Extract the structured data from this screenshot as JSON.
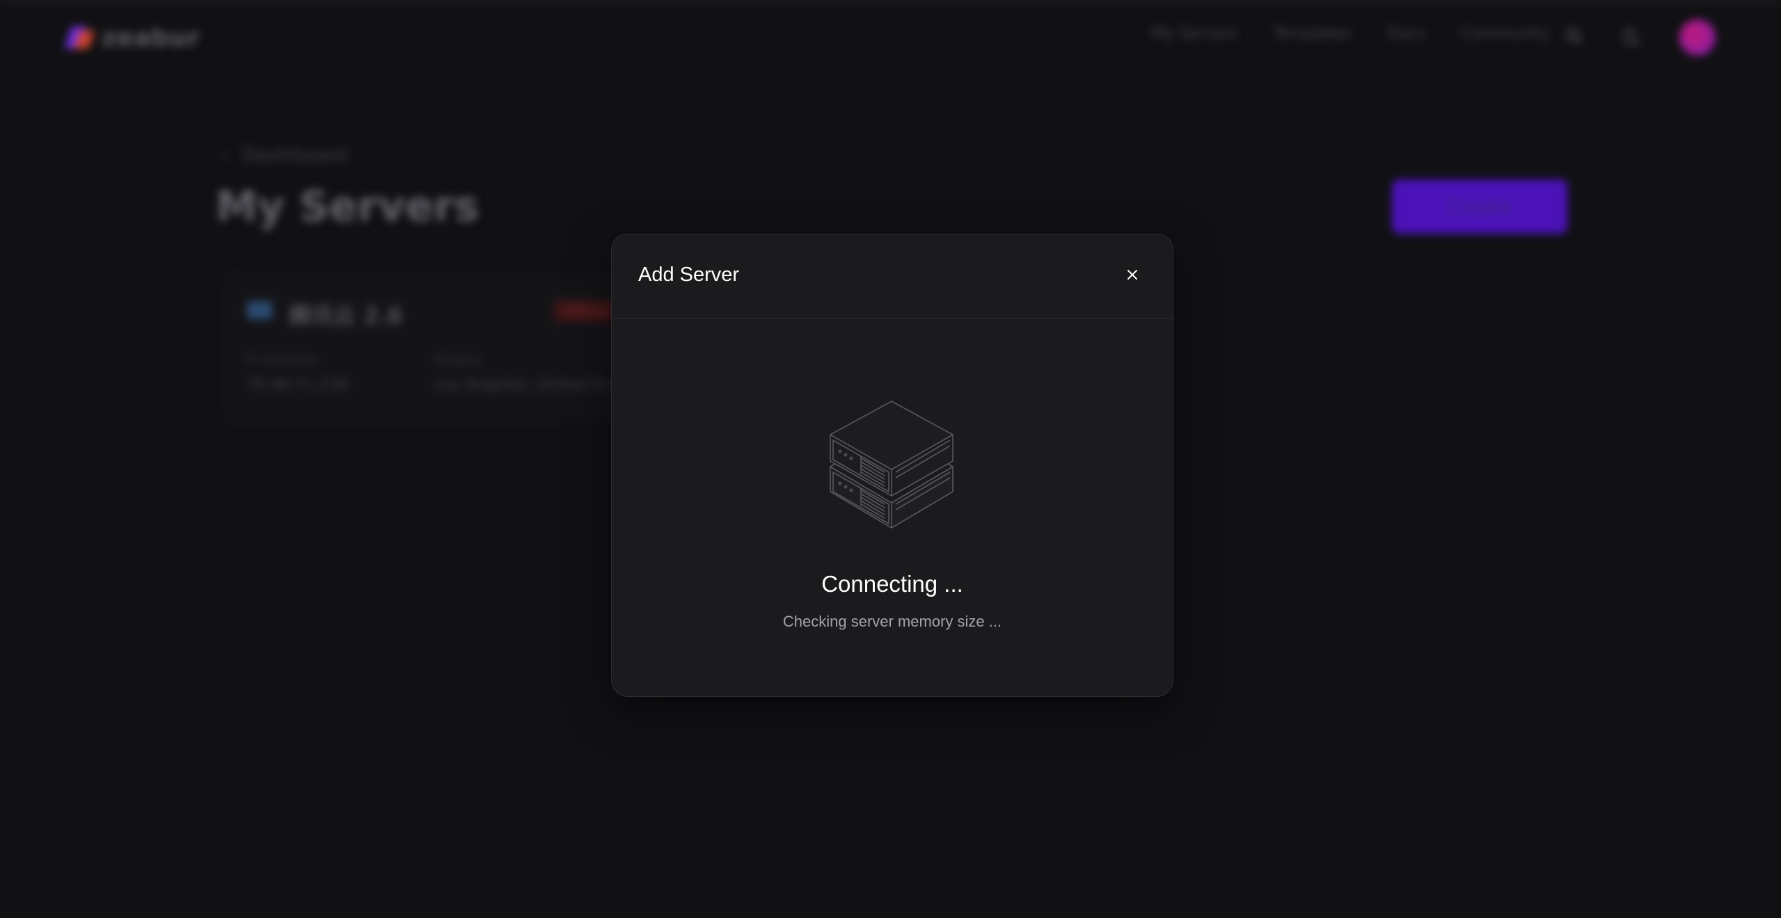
{
  "app": {
    "logo_text": "zeabur"
  },
  "nav": {
    "links": [
      "My Servers",
      "Templates",
      "Docs",
      "Community"
    ],
    "search_icon": "search-icon",
    "theme_icon": "moon-icon"
  },
  "page": {
    "breadcrumb": "Dashboard",
    "title": "My Servers",
    "create_label": "Create"
  },
  "server_card": {
    "name": "腾讯云 2.6",
    "status": "Offline",
    "ip_label": "IP Address",
    "ip_value": "76.48.71.238",
    "region_label": "Region",
    "region_value": "Los Angeles, United States"
  },
  "modal": {
    "title": "Add Server",
    "close_icon": "close-icon",
    "illustration": "server-stack-icon",
    "status_title": "Connecting ...",
    "status_sub": "Checking server memory size ..."
  },
  "colors": {
    "background": "#111114",
    "modal_bg": "#1b1b1e",
    "accent": "#4b12b8"
  }
}
